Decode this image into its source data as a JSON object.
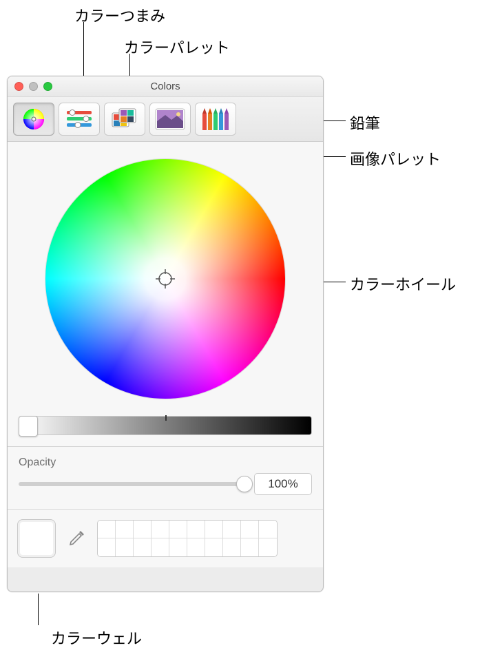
{
  "window": {
    "title": "Colors"
  },
  "toolbar": {
    "items": [
      {
        "name": "color-wheel-tab"
      },
      {
        "name": "color-sliders-tab"
      },
      {
        "name": "color-palettes-tab"
      },
      {
        "name": "image-palettes-tab"
      },
      {
        "name": "pencils-tab"
      }
    ]
  },
  "opacity": {
    "label": "Opacity",
    "value": "100%"
  },
  "callouts": {
    "sliders": "カラーつまみ",
    "palettes": "カラーパレット",
    "pencils": "鉛筆",
    "image": "画像パレット",
    "wheel": "カラーホイール",
    "well": "カラーウェル"
  }
}
